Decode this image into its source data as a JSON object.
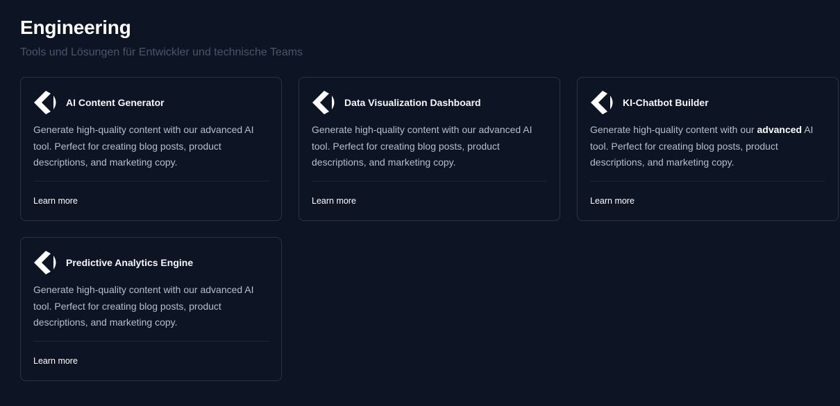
{
  "section": {
    "title": "Engineering",
    "subtitle": "Tools und Lösungen für Entwickler und technische Teams"
  },
  "cards": [
    {
      "icon": "chevron-bracket-logo-icon",
      "title": "AI Content Generator",
      "description": "Generate high-quality content with our advanced AI tool. Perfect for creating blog posts, product descriptions, and marketing copy.",
      "link_label": "Learn more"
    },
    {
      "icon": "chevron-bracket-logo-icon",
      "title": "Data Visualization Dashboard",
      "description": "Generate high-quality content with our advanced AI tool. Perfect for creating blog posts, product descriptions, and marketing copy.",
      "link_label": "Learn more"
    },
    {
      "icon": "chevron-bracket-logo-icon",
      "title": "KI-Chatbot Builder",
      "description_before": "Generate high-quality content with our ",
      "description_emphasis": "advanced",
      "description_after": " AI tool. Perfect for creating blog posts, product descriptions, and marketing copy.",
      "link_label": "Learn more"
    },
    {
      "icon": "chevron-bracket-logo-icon",
      "title": "Predictive Analytics Engine",
      "description": "Generate high-quality content with our advanced AI tool. Perfect for creating blog posts, product descriptions, and marketing copy.",
      "link_label": "Learn more"
    }
  ],
  "colors": {
    "background": "#0d1424",
    "card_border": "#2b3445",
    "subtitle": "#4a5568",
    "body_text": "#b7bfcb"
  }
}
